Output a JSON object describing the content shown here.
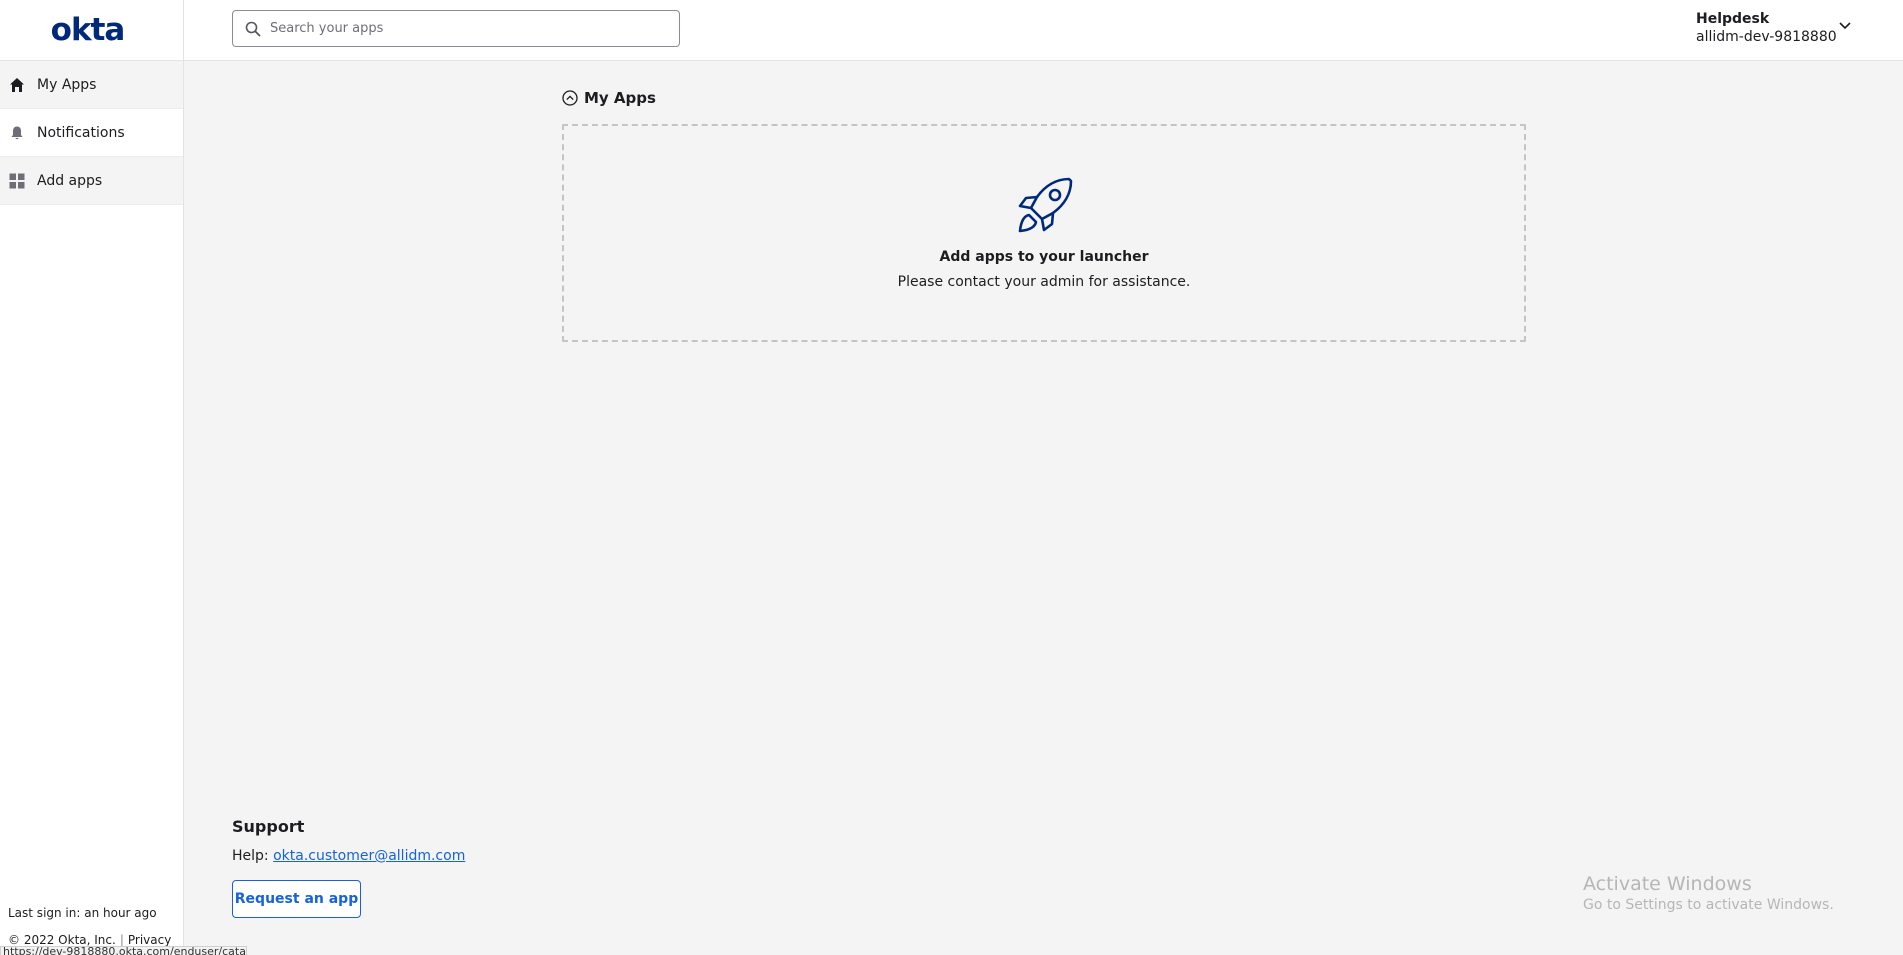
{
  "header": {
    "logo_text": "okta",
    "search_placeholder": "Search your apps",
    "user_name": "Helpdesk",
    "user_org": "allidm-dev-9818880"
  },
  "sidebar": {
    "items": [
      {
        "label": "My Apps",
        "icon": "home-icon"
      },
      {
        "label": "Notifications",
        "icon": "bell-icon"
      },
      {
        "label": "Add apps",
        "icon": "grid-icon"
      }
    ],
    "last_signin": "Last sign in: an hour ago",
    "copyright": "© 2022 Okta, Inc.",
    "privacy": "Privacy",
    "status_url": "https://dev-9818880.okta.com/enduser/catalog"
  },
  "main": {
    "section_title": "My Apps",
    "empty_title": "Add apps to your launcher",
    "empty_subtitle": "Please contact your admin for assistance."
  },
  "support": {
    "title": "Support",
    "help_label": "Help:",
    "help_email": "okta.customer@allidm.com",
    "request_button": "Request an app"
  },
  "watermark": {
    "line1": "Activate Windows",
    "line2": "Go to Settings to activate Windows."
  },
  "colors": {
    "brand": "#00297a",
    "link": "#1662dd",
    "background": "#f4f4f4"
  }
}
